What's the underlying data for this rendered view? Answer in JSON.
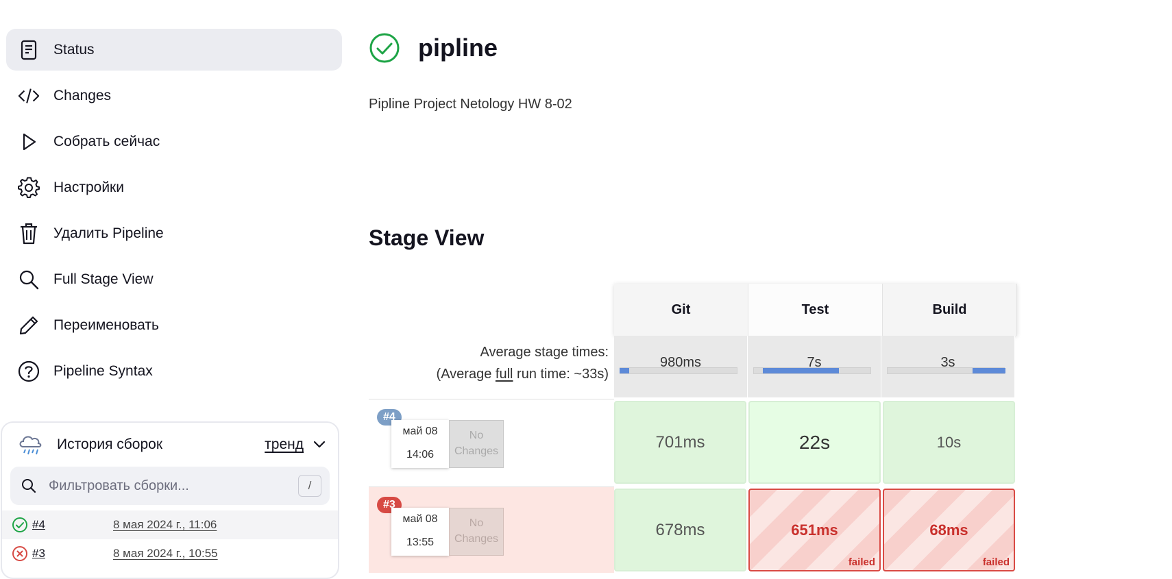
{
  "sidebar": {
    "items": [
      {
        "label": "Status",
        "icon": "document-icon"
      },
      {
        "label": "Changes",
        "icon": "code-icon"
      },
      {
        "label": "Собрать сейчас",
        "icon": "play-icon"
      },
      {
        "label": "Настройки",
        "icon": "gear-icon"
      },
      {
        "label": "Удалить Pipeline",
        "icon": "trash-icon"
      },
      {
        "label": "Full Stage View",
        "icon": "search-icon"
      },
      {
        "label": "Переименовать",
        "icon": "pencil-icon"
      },
      {
        "label": "Pipeline Syntax",
        "icon": "help-circle-icon"
      }
    ]
  },
  "history": {
    "title": "История сборок",
    "trend_label": "тренд",
    "filter_placeholder": "Фильтровать сборки...",
    "shortcut": "/",
    "builds": [
      {
        "number": "#4",
        "date": "8 мая 2024 г., 11:06",
        "status": "success"
      },
      {
        "number": "#3",
        "date": "8 мая 2024 г., 10:55",
        "status": "failed"
      }
    ]
  },
  "main": {
    "title": "pipline",
    "status": "success",
    "description": "Pipline Project Netology HW 8-02",
    "section_title": "Stage View"
  },
  "stage_view": {
    "stages": [
      "Git",
      "Test",
      "Build"
    ],
    "average_label": "Average stage times:",
    "full_run_prefix": "(Average ",
    "full_run_link": "full",
    "full_run_suffix": " run time: ~33s)",
    "average_times": [
      "980ms",
      "7s",
      "3s"
    ],
    "average_bars": [
      {
        "start": 0.0,
        "fill": 0.08
      },
      {
        "start": 0.08,
        "fill": 0.64
      },
      {
        "start": 0.72,
        "fill": 0.28
      }
    ],
    "runs": [
      {
        "badge": "#4",
        "date": "май 08",
        "time": "14:06",
        "changes": "No Changes",
        "status": "success",
        "cells": [
          {
            "value": "701ms",
            "state": "success"
          },
          {
            "value": "22s",
            "state": "success"
          },
          {
            "value": "10s",
            "state": "success"
          }
        ]
      },
      {
        "badge": "#3",
        "date": "май 08",
        "time": "13:55",
        "changes": "No Changes",
        "status": "failed",
        "cells": [
          {
            "value": "678ms",
            "state": "success"
          },
          {
            "value": "651ms",
            "state": "failed",
            "state_label": "failed"
          },
          {
            "value": "68ms",
            "state": "failed",
            "state_label": "failed"
          }
        ]
      }
    ]
  },
  "colors": {
    "success": "#1ea446",
    "failed": "#d74a44",
    "bar": "#5d8ad8",
    "active_nav": "#ebecf1"
  }
}
